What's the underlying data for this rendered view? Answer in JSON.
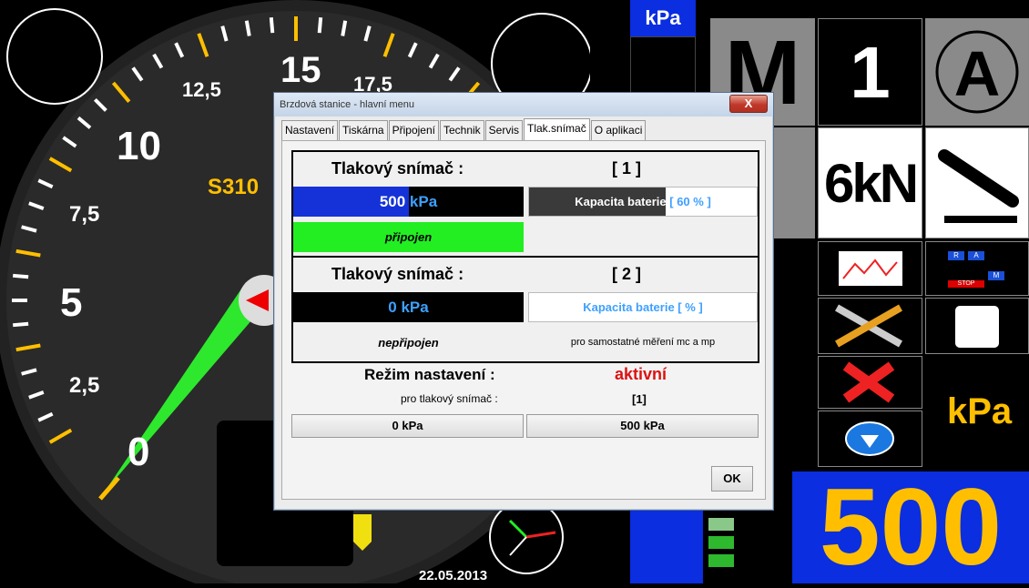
{
  "background": {
    "tick_labels": [
      "0",
      "2,5",
      "5",
      "7,5",
      "10",
      "12,5",
      "15",
      "17,5"
    ],
    "device_label": "S310",
    "date": "22.05.2013"
  },
  "right_panel": {
    "top_unit": "kPa",
    "mode_letter": "M",
    "gear_number": "1",
    "auto_letter": "A",
    "force_label": "6kN",
    "remote_keys": [
      "R",
      "A",
      "STOP",
      "M"
    ],
    "unit_label": "kPa",
    "big_value": "500"
  },
  "dialog": {
    "title": "Brzdová stanice - hlavní menu",
    "close_label": "X",
    "tabs": [
      "Nastavení",
      "Tiskárna",
      "Připojení",
      "Technik",
      "Servis",
      "Tlak.snímač",
      "O aplikaci"
    ],
    "active_tab": "Tlak.snímač",
    "sensor1": {
      "title": "Tlakový snímač :",
      "index": "[ 1 ]",
      "value": "500",
      "unit": "kPa",
      "fill_fraction": 0.5,
      "battery_label": "Kapacita baterie",
      "battery_value": "[ 60 % ]",
      "battery_fraction": 0.6,
      "status": "připojen",
      "status_color": "#22ee22"
    },
    "sensor2": {
      "title": "Tlakový snímač :",
      "index": "[ 2 ]",
      "value": "0",
      "unit": "kPa",
      "fill_fraction": 0,
      "battery_label": "Kapacita baterie [ % ]",
      "status": "nepřipojen",
      "note": "pro samostatné měření mc a mp"
    },
    "mode": {
      "label": "Režim nastavení :",
      "value": "aktivní",
      "value_color": "#dd1111",
      "sub_label": "pro tlakový snímač :",
      "sub_value": "[1]",
      "btn_low": "0 kPa",
      "btn_high": "500 kPa"
    },
    "ok_label": "OK"
  },
  "colors": {
    "accent_yellow": "#ffbf00",
    "bar_blue": "#1432d8",
    "dial_green": "#2ee82e"
  }
}
